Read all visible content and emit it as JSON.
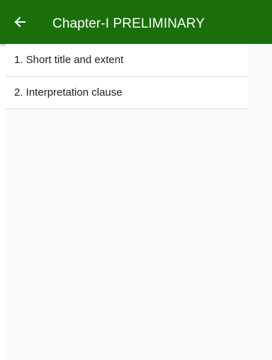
{
  "app_bar": {
    "title": "Chapter-I PRELIMINARY",
    "back_icon": "arrow-left-icon",
    "background": "#1b6f0b"
  },
  "sections": [
    {
      "label": "1. Short title and extent"
    },
    {
      "label": "2.  Interpretation clause"
    }
  ]
}
